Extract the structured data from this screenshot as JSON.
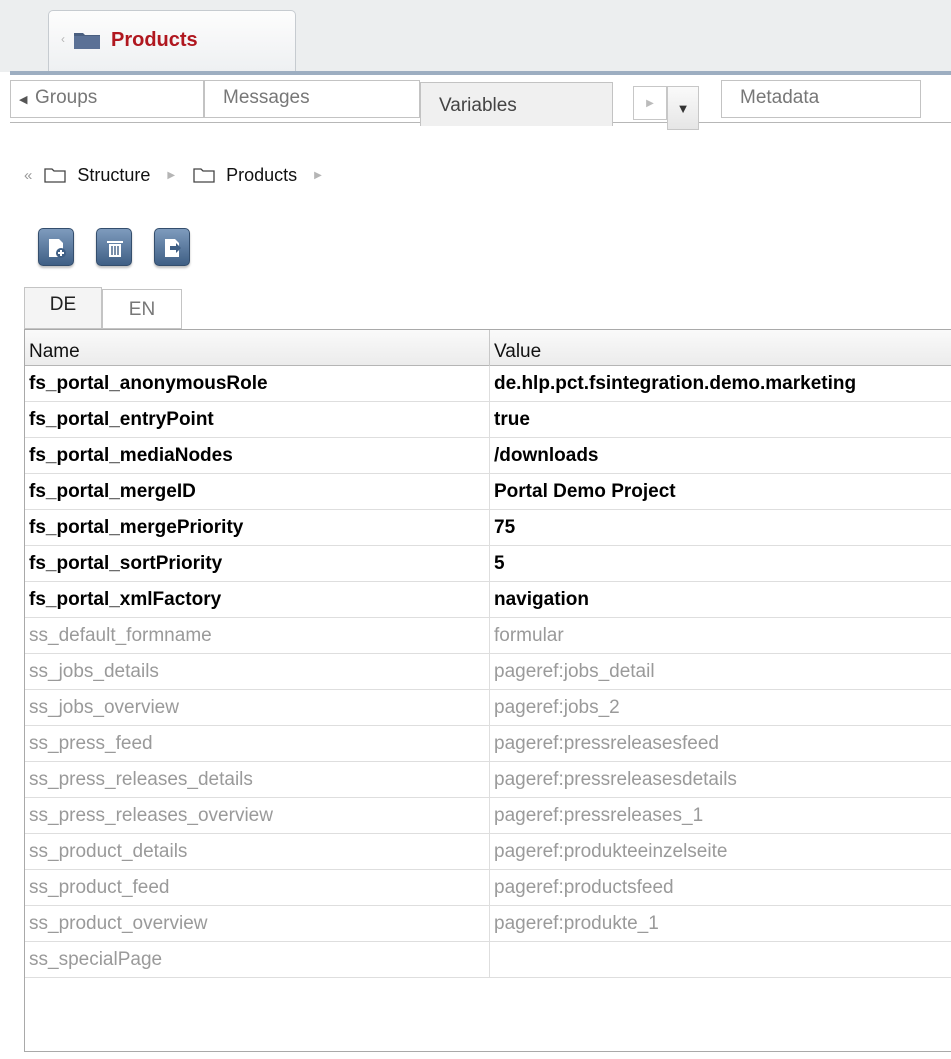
{
  "top_tab": {
    "title": "Products",
    "icon": "folder-icon"
  },
  "secondary_tabs": [
    {
      "label": "Groups"
    },
    {
      "label": "Messages"
    },
    {
      "label": "Variables",
      "active": true
    },
    {
      "label": "Metadata"
    }
  ],
  "breadcrumb": {
    "items": [
      "Structure",
      "Products"
    ]
  },
  "toolbar": {
    "buttons": [
      "add-entry-icon",
      "delete-icon",
      "export-icon"
    ]
  },
  "language_tabs": [
    {
      "label": "DE",
      "active": true
    },
    {
      "label": "EN"
    }
  ],
  "table": {
    "columns": [
      "Name",
      "Value"
    ],
    "rows": [
      {
        "name": "fs_portal_anonymousRole",
        "value": "de.hlp.pct.fsintegration.demo.marketing",
        "style": "bold"
      },
      {
        "name": "fs_portal_entryPoint",
        "value": "true",
        "style": "bold"
      },
      {
        "name": "fs_portal_mediaNodes",
        "value": "/downloads",
        "style": "bold"
      },
      {
        "name": "fs_portal_mergeID",
        "value": "Portal Demo Project",
        "style": "bold"
      },
      {
        "name": "fs_portal_mergePriority",
        "value": "75",
        "style": "bold"
      },
      {
        "name": "fs_portal_sortPriority",
        "value": "5",
        "style": "bold"
      },
      {
        "name": "fs_portal_xmlFactory",
        "value": "navigation",
        "style": "bold"
      },
      {
        "name": "ss_default_formname",
        "value": "formular",
        "style": "gray"
      },
      {
        "name": "ss_jobs_details",
        "value": "pageref:jobs_detail",
        "style": "gray"
      },
      {
        "name": "ss_jobs_overview",
        "value": "pageref:jobs_2",
        "style": "gray"
      },
      {
        "name": "ss_press_feed",
        "value": "pageref:pressreleasesfeed",
        "style": "gray"
      },
      {
        "name": "ss_press_releases_details",
        "value": "pageref:pressreleasesdetails",
        "style": "gray"
      },
      {
        "name": "ss_press_releases_overview",
        "value": "pageref:pressreleases_1",
        "style": "gray"
      },
      {
        "name": "ss_product_details",
        "value": "pageref:produkteeinzelseite",
        "style": "gray"
      },
      {
        "name": "ss_product_feed",
        "value": "pageref:productsfeed",
        "style": "gray"
      },
      {
        "name": "ss_product_overview",
        "value": "pageref:produkte_1",
        "style": "gray"
      },
      {
        "name": "ss_specialPage",
        "value": "",
        "style": "gray"
      }
    ]
  }
}
